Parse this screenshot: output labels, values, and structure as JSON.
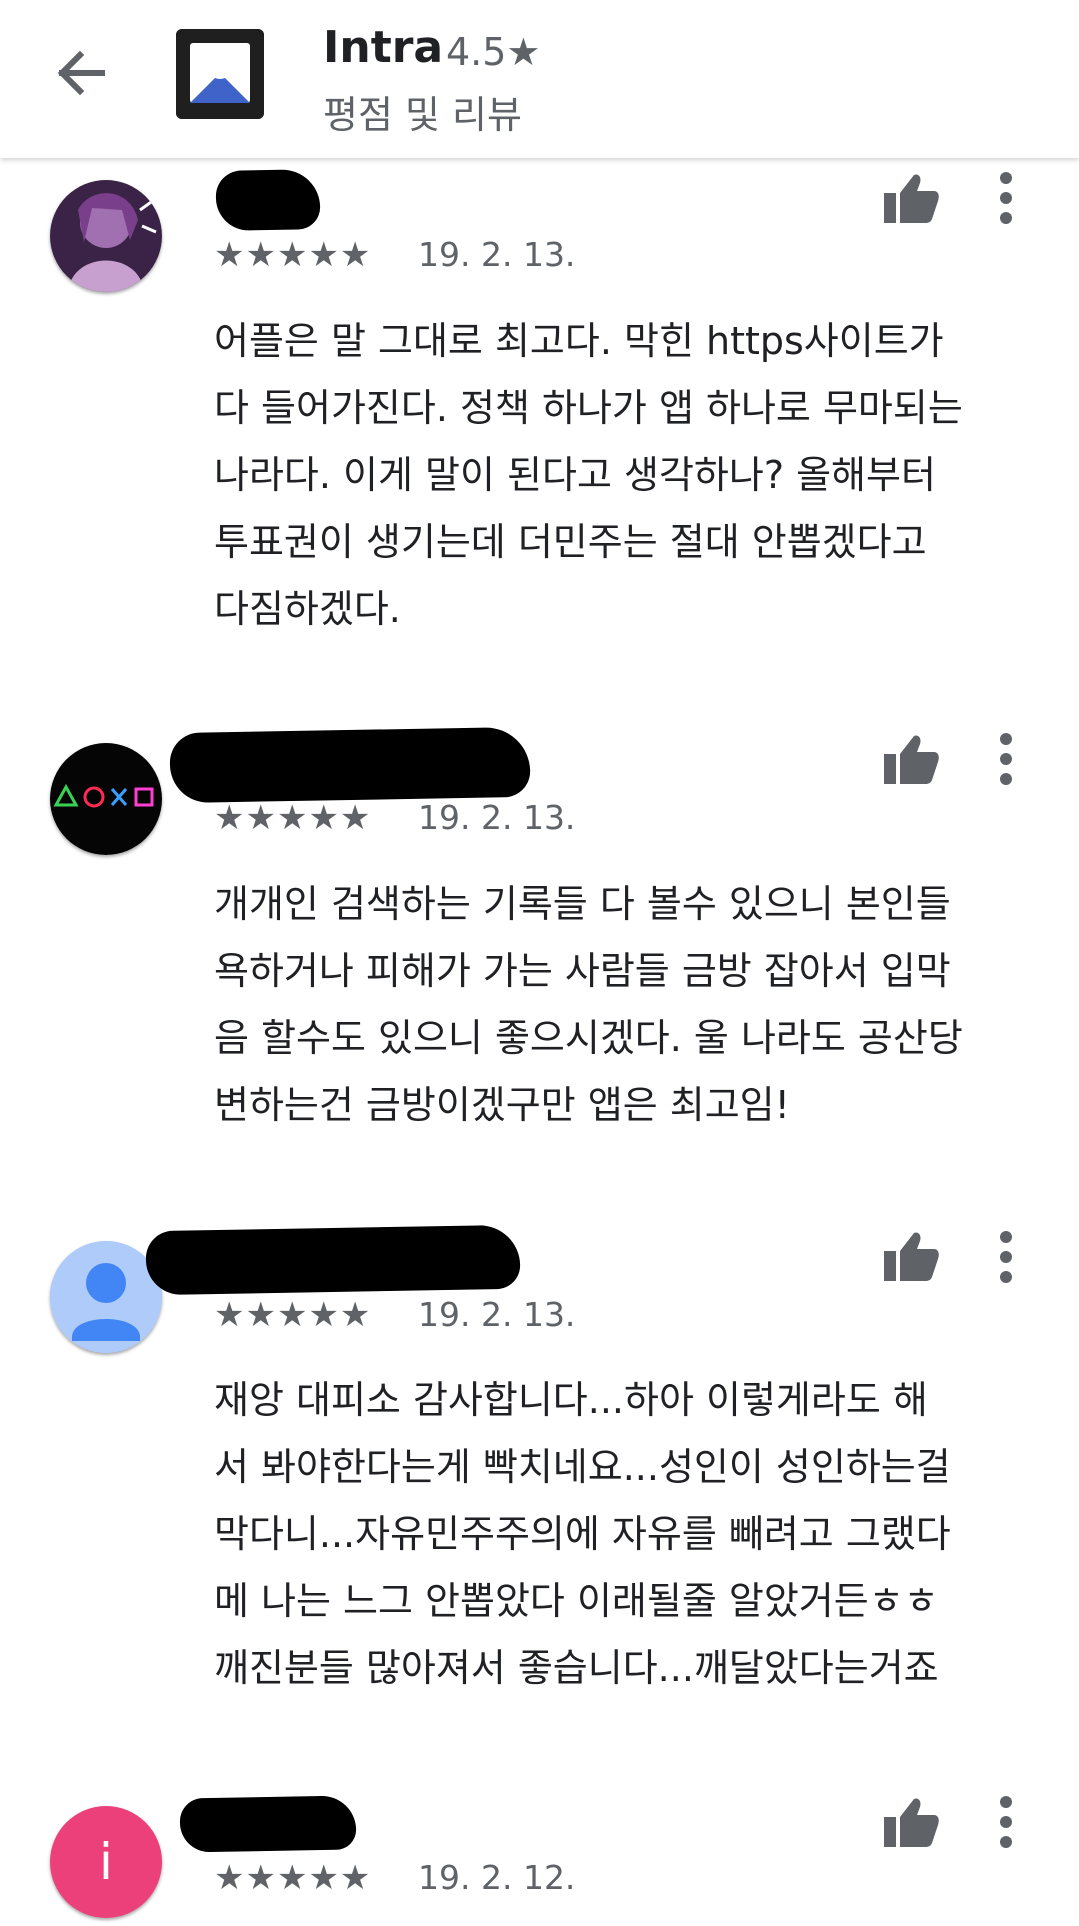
{
  "header": {
    "app_name": "Intra",
    "rating": "4.5★",
    "subtitle": "평점 및 리뷰"
  },
  "reviews": [
    {
      "stars": "★★★★★",
      "date": "19. 2. 13.",
      "text": "어플은 말 그대로 최고다. 막힌 https사이트가\n다 들어가진다. 정책 하나가 앱 하나로 무마되는\n나라다. 이게 말이 된다고 생각하나? 올해부터\n투표권이 생기는데 더민주는 절대 안뽑겠다고\n다짐하겠다."
    },
    {
      "stars": "★★★★★",
      "date": "19. 2. 13.",
      "text": "개개인 검색하는 기록들 다 볼수 있으니 본인들\n욕하거나 피해가 가는 사람들 금방 잡아서 입막\n음 할수도 있으니 좋으시겠다. 울 나라도 공산당\n변하는건 금방이겠구만 앱은 최고임!"
    },
    {
      "stars": "★★★★★",
      "date": "19. 2. 13.",
      "text": "재앙 대피소 감사합니다...하아 이렇게라도 해\n서 봐야한다는게 빡치네요...성인이 성인하는걸\n막다니...자유민주주의에 자유를 빼려고 그랬다\n메 나는 느그 안뽑았다 이래될줄 알았거든ㅎㅎ\n깨진분들 많아져서 좋습니다...깨달았다는거죠"
    },
    {
      "stars": "★★★★★",
      "date": "19. 2. 12.",
      "avatar_letter": "i",
      "text": ""
    }
  ],
  "colors": {
    "icon_gray": "#5f6368",
    "avatar_blue": "#aecbfa",
    "avatar_person": "#4285f4",
    "avatar_pink": "#ec407a"
  }
}
